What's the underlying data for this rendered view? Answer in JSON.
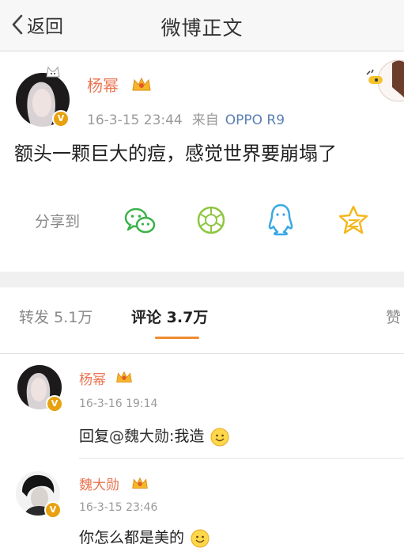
{
  "header": {
    "back_label": "返回",
    "title": "微博正文"
  },
  "post": {
    "author": "杨幂",
    "timestamp": "16-3-15 23:44",
    "source_prefix": "来自",
    "device": "OPPO R9",
    "text": "额头一颗巨大的痘，感觉世界要崩塌了",
    "share_label": "分享到",
    "share_targets": [
      "wechat-icon",
      "moments-icon",
      "qq-icon",
      "qzone-icon"
    ]
  },
  "tabs": {
    "repost_label": "转发",
    "repost_count": "5.1万",
    "comment_label": "评论",
    "comment_count": "3.7万",
    "like_label": "赞"
  },
  "comments": [
    {
      "author": "杨幂",
      "time": "16-3-16 19:14",
      "text_prefix": "回复",
      "mention": "@魏大勋",
      "text_suffix": ":我造"
    },
    {
      "author": "魏大勋",
      "time": "16-3-15 23:46",
      "text": "你怎么都是美的"
    }
  ],
  "colors": {
    "username": "#eb7350",
    "accent_tab": "#f08c31",
    "verified_badge": "#e8a10f",
    "device_link": "#5a7fb4"
  }
}
